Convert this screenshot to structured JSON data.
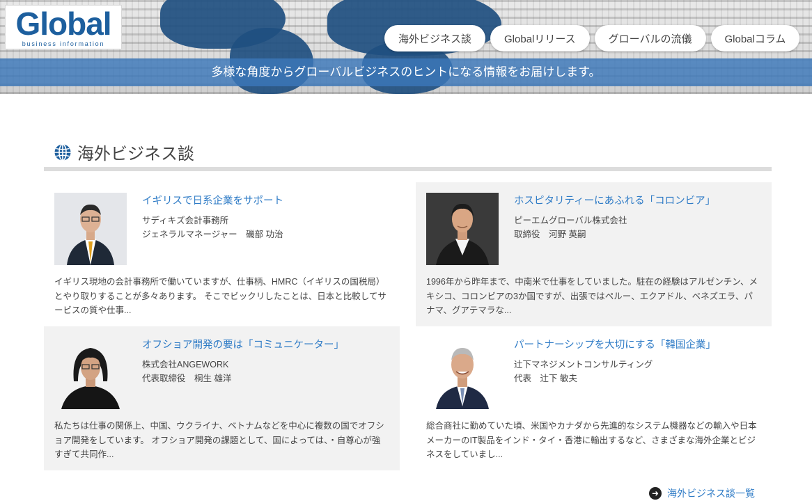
{
  "brand": {
    "logo_text": "Global",
    "logo_sub": "business information"
  },
  "nav": {
    "items": [
      {
        "label": "海外ビジネス談"
      },
      {
        "label": "Globalリリース"
      },
      {
        "label": "グローバルの流儀"
      },
      {
        "label": "Globalコラム"
      }
    ]
  },
  "tagline": "多様な角度からグローバルビジネスのヒントになる情報をお届けします。",
  "section": {
    "title": "海外ビジネス談"
  },
  "articles": [
    {
      "title": "イギリスで日系企業をサポート",
      "company": "サディキズ会計事務所",
      "person": "ジェネラルマネージャー　磯部 功治",
      "excerpt": "イギリス現地の会計事務所で働いていますが、仕事柄、HMRC（イギリスの国税局）とやり取りすることが多々あります。 そこでビックリしたことは、日本と比較してサービスの質や仕事..."
    },
    {
      "title": "ホスピタリティーにあふれる「コロンビア」",
      "company": "ピーエムグローバル株式会社",
      "person": "取締役　河野 英嗣",
      "excerpt": "1996年から昨年まで、中南米で仕事をしていました。駐在の経験はアルゼンチン、メキシコ、コロンビアの3か国ですが、出張ではペルー、エクアドル、ベネズエラ、パナマ、グアテマラな..."
    },
    {
      "title": "オフショア開発の要は「コミュニケーター」",
      "company": "株式会社ANGEWORK",
      "person": "代表取締役　桐生 雄洋",
      "excerpt": "私たちは仕事の関係上、中国、ウクライナ、ベトナムなどを中心に複数の国でオフショア開発をしています。 オフショア開発の課題として、国によっては、・自尊心が強すぎて共同作..."
    },
    {
      "title": "パートナーシップを大切にする「韓国企業」",
      "company": "辻下マネジメントコンサルティング",
      "person": "代表　辻下 敏夫",
      "excerpt": "総合商社に勤めていた頃、米国やカナダから先進的なシステム機器などの輸入や日本メーカーのIT製品をインド・タイ・香港に輸出するなど、さまざまな海外企業とビジネスをしていまし..."
    }
  ],
  "more_link": {
    "label": "海外ビジネス談一覧"
  },
  "colors": {
    "accent": "#2e7bc6",
    "brand": "#1d5f9e",
    "tagline_bar": "#3c78b9"
  }
}
